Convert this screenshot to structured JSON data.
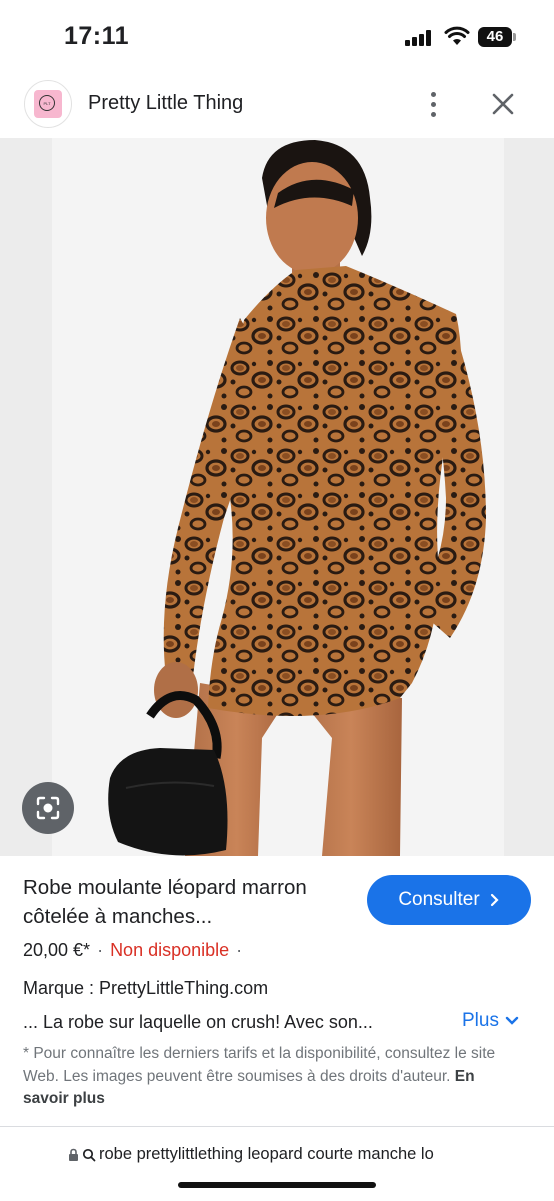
{
  "status_bar": {
    "time": "17:11",
    "battery": "46"
  },
  "header": {
    "site_name": "Pretty Little Thing",
    "logo_text": "PLT"
  },
  "product": {
    "title": "Robe moulante léopard marron côtelée à manches...",
    "consult_label": "Consulter",
    "price": "20,00 €*",
    "availability": "Non disponible",
    "brand": "Marque : PrettyLittleThing.com",
    "description": "... La robe sur laquelle on crush! Avec son...",
    "more_label": "Plus",
    "disclaimer": "* Pour connaître les derniers tarifs et la disponibilité, consultez le site Web. Les images peuvent être soumises à des droits d'auteur.",
    "learn_more": "En savoir plus"
  },
  "url_bar": {
    "query": "robe prettylittlething leopard courte manche lo"
  },
  "colors": {
    "accent": "#1a73e8",
    "unavailable": "#d93025",
    "leopard_base": "#b8743a",
    "leopard_spot": "#2a1b12"
  },
  "icons": [
    "signal-icon",
    "wifi-icon",
    "battery-icon",
    "more-vert-icon",
    "close-icon",
    "lens-icon",
    "chevron-right-icon",
    "chevron-down-icon",
    "lock-icon",
    "search-icon"
  ]
}
